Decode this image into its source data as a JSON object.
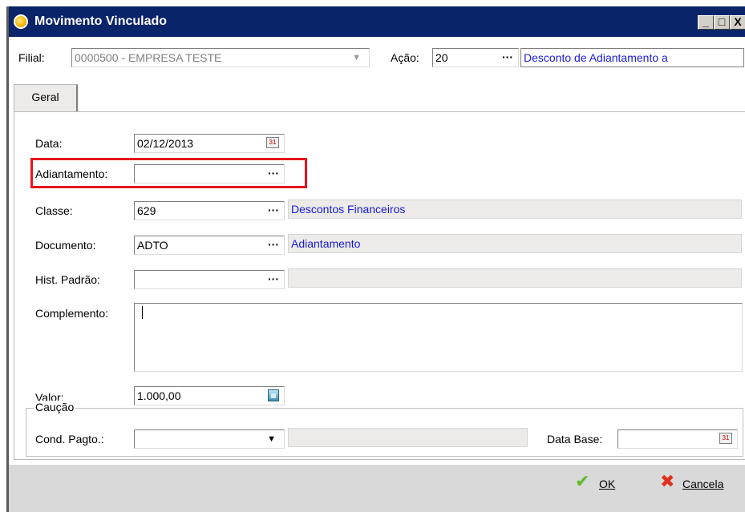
{
  "window": {
    "title": "Movimento Vinculado",
    "buttons": {
      "minimize": "_",
      "maximize": "□",
      "close": "X"
    }
  },
  "header": {
    "filial_label": "Filial:",
    "filial_value": "0000500 - EMPRESA TESTE",
    "acao_label": "Ação:",
    "acao_value": "20",
    "acao_lookup": "···",
    "acao_desc": "Desconto de Adiantamento a"
  },
  "tabs": [
    {
      "label": "Geral"
    }
  ],
  "form": {
    "data_label": "Data:",
    "data_value": "02/12/2013",
    "adiantamento_label": "Adiantamento:",
    "adiantamento_value": "",
    "classe_label": "Classe:",
    "classe_value": "629",
    "classe_desc": "Descontos Financeiros",
    "documento_label": "Documento:",
    "documento_value": "ADTO",
    "documento_desc": "Adiantamento",
    "hist_label": "Hist. Padrão:",
    "hist_value": "",
    "hist_desc": "",
    "complemento_label": "Complemento:",
    "complemento_value": "",
    "valor_label": "Valor:",
    "valor_value": "1.000,00",
    "lookup": "···",
    "calendar_glyph": "31",
    "calc_glyph": "▦"
  },
  "caucao": {
    "title": "Caução",
    "cond_label": "Cond. Pagto.:",
    "cond_value": "",
    "cond_desc": "",
    "data_base_label": "Data Base:",
    "data_base_value": ""
  },
  "footer": {
    "ok_label": "OK",
    "cancel_label": "Cancela"
  },
  "colors": {
    "titlebar": "#0a246a",
    "highlight": "#e8141c",
    "desc_text": "#1a1ad6",
    "footer": "#d9d9d9"
  }
}
